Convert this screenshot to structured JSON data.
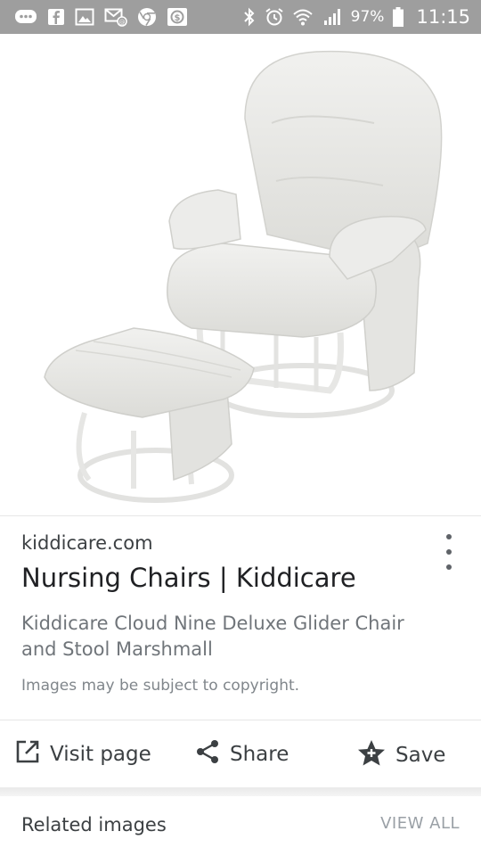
{
  "status_bar": {
    "battery": "97%",
    "time": "11:15",
    "left_icons": [
      "chat-icon",
      "facebook-icon",
      "gallery-icon",
      "email-icon",
      "chrome-icon",
      "app-icon"
    ],
    "right_icons": [
      "bluetooth-icon",
      "alarm-icon",
      "wifi-icon",
      "signal-icon",
      "battery-icon"
    ]
  },
  "image": {
    "subject": "nursing-chair-with-stool",
    "colors": {
      "upholstery": "#e9e9e6",
      "frame": "#f2f2f2",
      "shadow": "#cfcfcb"
    }
  },
  "result": {
    "domain": "kiddicare.com",
    "title": "Nursing Chairs | Kiddicare",
    "description": "Kiddicare Cloud Nine Deluxe Glider Chair and Stool Marshmall",
    "copyright": "Images may be subject to copyright."
  },
  "actions": {
    "visit": "Visit page",
    "share": "Share",
    "save": "Save"
  },
  "related": {
    "title": "Related images",
    "view_all": "VIEW ALL"
  },
  "colors": {
    "status_bar_bg": "#9e9e9e",
    "text_primary": "#202124",
    "text_secondary": "#70757a"
  }
}
